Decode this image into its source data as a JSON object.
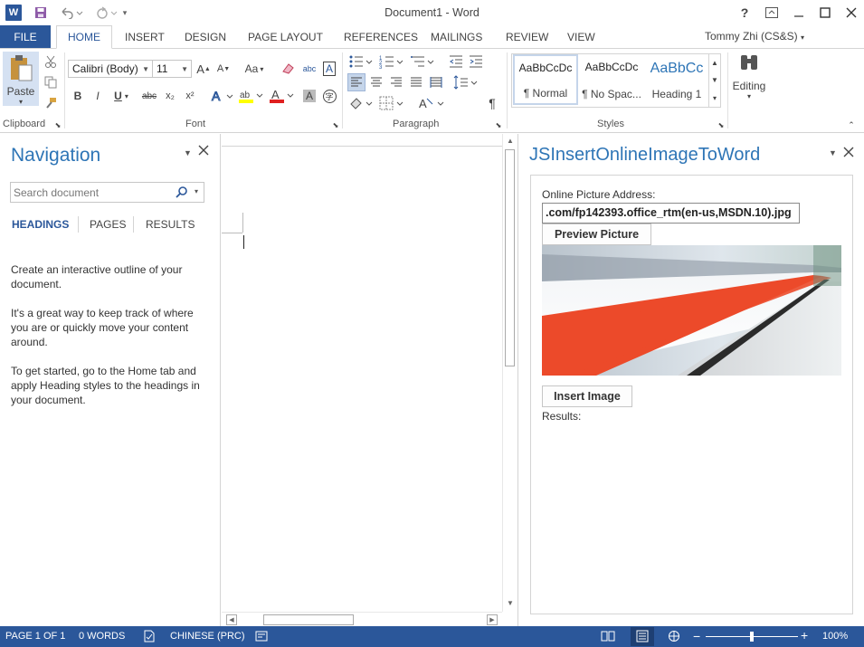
{
  "titlebar": {
    "title": "Document1 - Word",
    "app_icon_label": "W",
    "icons": [
      "word-app-icon",
      "save-icon",
      "undo-icon",
      "redo-icon",
      "customize-qat-icon",
      "help-icon",
      "ribbon-display-icon",
      "minimize-icon",
      "maximize-icon",
      "close-icon"
    ]
  },
  "tabs": {
    "file": "FILE",
    "items": [
      "HOME",
      "INSERT",
      "DESIGN",
      "PAGE LAYOUT",
      "REFERENCES",
      "MAILINGS",
      "REVIEW",
      "VIEW"
    ],
    "active": "HOME"
  },
  "user": {
    "name": "Tommy Zhi (CS&S)"
  },
  "ribbon": {
    "clipboard": {
      "paste_label": "Paste",
      "group_label": "Clipboard"
    },
    "font": {
      "font_name": "Calibri (Body)",
      "font_size": "11",
      "group_label": "Font",
      "change_case": "Aa",
      "bold": "B",
      "italic": "I",
      "underline": "U",
      "strike": "abc",
      "subscript": "x₂",
      "superscript": "x²"
    },
    "paragraph": {
      "group_label": "Paragraph"
    },
    "styles": {
      "group_label": "Styles",
      "items": [
        {
          "sample": "AaBbCcDc",
          "name": "¶ Normal"
        },
        {
          "sample": "AaBbCcDc",
          "name": "¶ No Spac..."
        },
        {
          "sample": "AaBbCc",
          "name": "Heading 1"
        }
      ]
    },
    "editing": {
      "label": "Editing"
    }
  },
  "navigation": {
    "title": "Navigation",
    "search_placeholder": "Search document",
    "tabs": [
      "HEADINGS",
      "PAGES",
      "RESULTS"
    ],
    "active_tab": "HEADINGS",
    "paragraphs": [
      "Create an interactive outline of your document.",
      "It's a great way to keep track of where you are or quickly move your content around.",
      "To get started, go to the Home tab and apply Heading styles to the headings in your document."
    ]
  },
  "taskpane": {
    "title": "JSInsertOnlineImageToWord",
    "address_label": "Online Picture Address:",
    "address_value": ".com/fp142393.office_rtm(en-us,MSDN.10).jpg",
    "preview_button": "Preview Picture",
    "insert_button": "Insert Image",
    "results_label": "Results:"
  },
  "statusbar": {
    "page": "PAGE 1 OF 1",
    "words": "0 WORDS",
    "language": "CHINESE (PRC)",
    "zoom": "100%",
    "zoom_level": 1.0
  },
  "colors": {
    "accent": "#2b579a",
    "title_blue": "#2e75b6"
  }
}
